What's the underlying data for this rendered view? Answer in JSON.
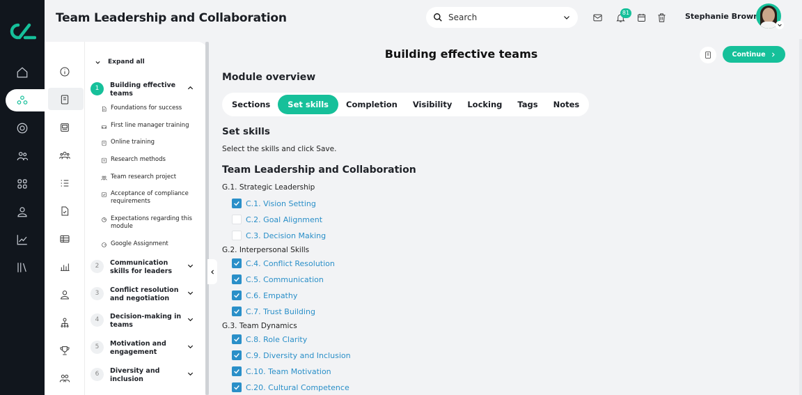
{
  "header": {
    "app_title": "Team Leadership and Collaboration",
    "search_placeholder": "Search",
    "notification_count": "81",
    "user_name": "Stephanie Brown"
  },
  "rail": {
    "items": [
      "home-icon",
      "collaboration-icon",
      "target-icon",
      "people-icon",
      "apps-icon",
      "user-icon",
      "analytics-icon",
      "library-icon"
    ],
    "active": "collaboration-icon"
  },
  "course_panel": {
    "expand_all": "Expand all",
    "icon_column": [
      "info-icon",
      "book-icon",
      "news-icon",
      "group-icon",
      "list-icon",
      "document-icon",
      "table-icon",
      "bar-chart-icon",
      "person-icon",
      "org-icon",
      "trophy-icon",
      "team-icon"
    ],
    "modules": [
      {
        "num": "1",
        "title": "Building effective teams",
        "expanded": true,
        "items": [
          {
            "icon": "document-icon",
            "label": "Foundations for success"
          },
          {
            "icon": "car-icon",
            "label": "First line manager training"
          },
          {
            "icon": "page-icon",
            "label": "Online training"
          },
          {
            "icon": "research-icon",
            "label": "Research methods"
          },
          {
            "icon": "team-icon",
            "label": "Team research project"
          },
          {
            "icon": "check-box-icon",
            "label": "Acceptance of compliance requirements"
          },
          {
            "icon": "pie-icon",
            "label": "Expectations regarding this module"
          },
          {
            "icon": "google-icon",
            "label": "Google Assignment"
          }
        ]
      },
      {
        "num": "2",
        "title": "Communication skills for leaders"
      },
      {
        "num": "3",
        "title": "Conflict resolution and negotiation"
      },
      {
        "num": "4",
        "title": "Decision-making in teams"
      },
      {
        "num": "5",
        "title": "Motivation and engagement"
      },
      {
        "num": "6",
        "title": "Diversity and inclusion"
      }
    ]
  },
  "main": {
    "page_title": "Building effective teams",
    "continue_label": "Continue",
    "module_overview": "Module overview",
    "tabs": [
      "Sections",
      "Set skills",
      "Completion",
      "Visibility",
      "Locking",
      "Tags",
      "Notes"
    ],
    "active_tab": "Set skills",
    "set_skills_title": "Set skills",
    "instructions": "Select the skills and click Save.",
    "framework_title": "Team Leadership and Collaboration",
    "groups": [
      {
        "label": "G.1. Strategic Leadership",
        "skills": [
          {
            "label": "C.1. Vision Setting",
            "checked": true
          },
          {
            "label": "C.2. Goal Alignment",
            "checked": false
          },
          {
            "label": "C.3. Decision Making",
            "checked": false
          }
        ]
      },
      {
        "label": "G.2. Interpersonal Skills",
        "skills": [
          {
            "label": "C.4. Conflict Resolution",
            "checked": true
          },
          {
            "label": "C.5. Communication",
            "checked": true
          },
          {
            "label": "C.6. Empathy",
            "checked": true
          },
          {
            "label": "C.7. Trust Building",
            "checked": true
          }
        ]
      },
      {
        "label": "G.3. Team Dynamics",
        "skills": [
          {
            "label": "C.8. Role Clarity",
            "checked": true
          },
          {
            "label": "C.9. Diversity and Inclusion",
            "checked": true
          },
          {
            "label": "C.10. Team Motivation",
            "checked": true
          },
          {
            "label": "C.20. Cultural Competence",
            "checked": true
          }
        ]
      }
    ]
  },
  "colors": {
    "accent": "#16c09a",
    "link": "#2a8fc8",
    "rail": "#11161d",
    "background": "#f2f3f5"
  }
}
